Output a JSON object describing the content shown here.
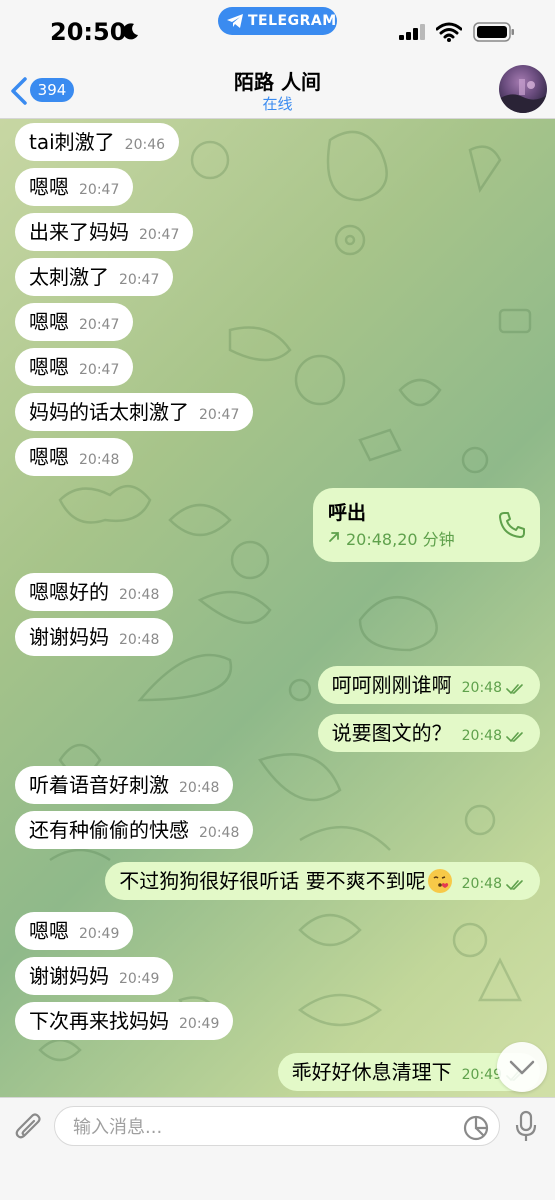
{
  "status_bar": {
    "time": "20:50",
    "app_pill": "TELEGRAM"
  },
  "header": {
    "back_count": "394",
    "title": "陌路 人间",
    "status": "在线"
  },
  "messages": [
    {
      "dir": "in",
      "text": "tai刺激了",
      "time": "20:46"
    },
    {
      "dir": "in",
      "text": "嗯嗯",
      "time": "20:47"
    },
    {
      "dir": "in",
      "text": "出来了妈妈",
      "time": "20:47"
    },
    {
      "dir": "in",
      "text": "太刺激了",
      "time": "20:47"
    },
    {
      "dir": "in",
      "text": "嗯嗯",
      "time": "20:47"
    },
    {
      "dir": "in",
      "text": "嗯嗯",
      "time": "20:47"
    },
    {
      "dir": "in",
      "text": "妈妈的话太刺激了",
      "time": "20:47"
    },
    {
      "dir": "in",
      "text": "嗯嗯",
      "time": "20:48"
    },
    {
      "dir": "in",
      "text": "嗯嗯好的",
      "time": "20:48"
    },
    {
      "dir": "in",
      "text": "谢谢妈妈",
      "time": "20:48"
    },
    {
      "dir": "out",
      "text": "呵呵刚刚谁啊",
      "time": "20:48"
    },
    {
      "dir": "out",
      "text": "说要图文的？",
      "time": "20:48"
    },
    {
      "dir": "in",
      "text": "听着语音好刺激",
      "time": "20:48"
    },
    {
      "dir": "in",
      "text": "还有种偷偷的快感",
      "time": "20:48"
    },
    {
      "dir": "out",
      "text": "不过狗狗很好很听话 要不爽不到呢",
      "time": "20:48"
    },
    {
      "dir": "in",
      "text": "嗯嗯",
      "time": "20:49"
    },
    {
      "dir": "in",
      "text": "谢谢妈妈",
      "time": "20:49"
    },
    {
      "dir": "in",
      "text": "下次再来找妈妈",
      "time": "20:49"
    },
    {
      "dir": "out",
      "text": "乖好好休息清理下",
      "time": "20:49"
    }
  ],
  "call": {
    "title": "呼出",
    "detail": "20:48,20 分钟"
  },
  "input": {
    "placeholder": "输入消息..."
  },
  "colors": {
    "accent": "#3a8bf0",
    "incoming_bubble": "#ffffff",
    "outgoing_bubble": "#e3f9c8",
    "outgoing_meta": "#5fa14c"
  },
  "icons": [
    "moon-icon",
    "telegram-plane-icon",
    "signal-icon",
    "wifi-icon",
    "battery-icon",
    "back-chevron-icon",
    "phone-icon",
    "double-check-icon",
    "chevron-down-icon",
    "paperclip-icon",
    "sticker-icon",
    "microphone-icon",
    "kiss-emoji-icon"
  ]
}
